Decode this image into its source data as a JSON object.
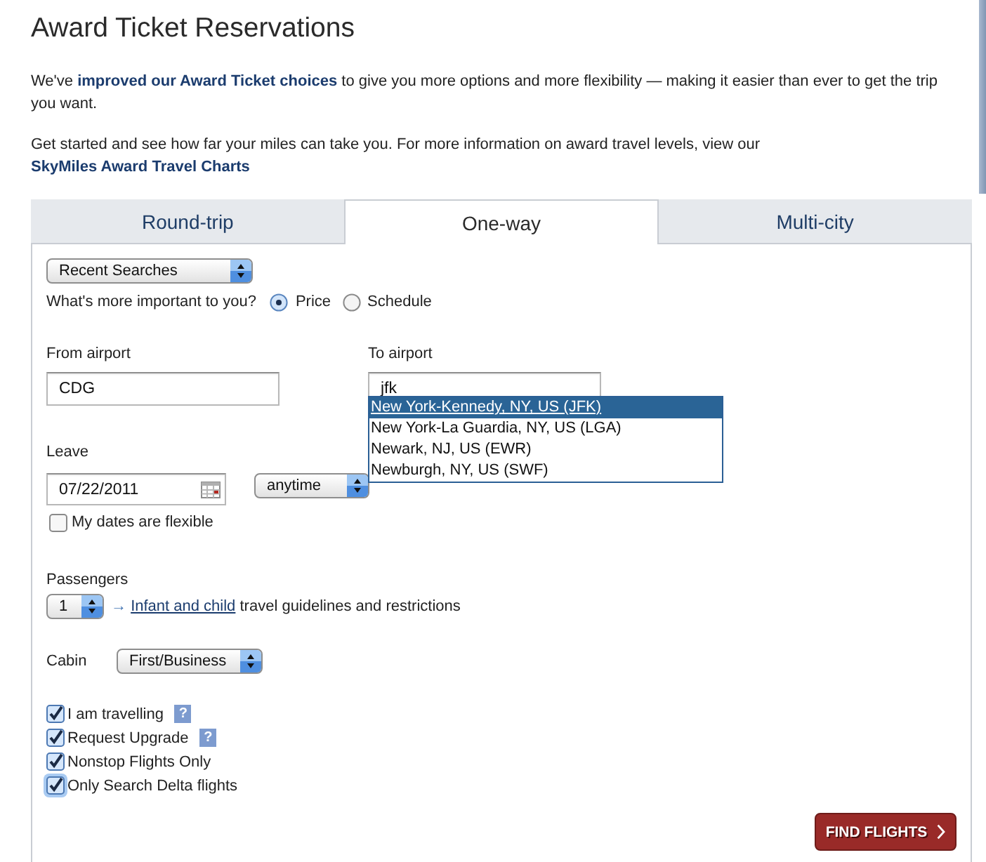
{
  "page": {
    "title": "Award Ticket Reservations"
  },
  "intro": [
    {
      "text": "We've ",
      "link": "improved our Award Ticket choices",
      "rest": " to give you more options and more flexibility — making it easier than ever to get the trip you want."
    },
    {
      "text": "Get started and see how far your miles can take you. For more information on award travel levels, view our ",
      "link": "SkyMiles Award Travel Charts"
    }
  ],
  "tabs": [
    {
      "label": "Round-trip",
      "selected": false
    },
    {
      "label": "One-way",
      "selected": true
    },
    {
      "label": "Multi-city",
      "selected": false
    }
  ],
  "recent_searches": {
    "value": "Recent Searches"
  },
  "preference": {
    "label": "What's more important to you?",
    "options": [
      {
        "label": "Price",
        "selected": true
      },
      {
        "label": "Schedule",
        "selected": false
      }
    ]
  },
  "from_airport": {
    "label": "From airport",
    "value": "CDG"
  },
  "to_airport": {
    "label": "To airport",
    "value": "jfk",
    "suggestions": [
      {
        "label": "New York-Kennedy, NY, US (JFK)",
        "selected": true
      },
      {
        "label": "New York-La Guardia, NY, US (LGA)",
        "selected": false
      },
      {
        "label": "Newark, NJ, US (EWR)",
        "selected": false
      },
      {
        "label": "Newburgh, NY, US (SWF)",
        "selected": false
      }
    ]
  },
  "leave": {
    "label": "Leave",
    "date": "07/22/2011",
    "time": "anytime",
    "flexible": {
      "label": "My dates are flexible",
      "checked": false
    }
  },
  "passengers": {
    "label": "Passengers",
    "value": "1",
    "arrow": "→",
    "link": "Infant and child",
    "rest": " travel guidelines and restrictions"
  },
  "cabin": {
    "label": "Cabin",
    "value": "First/Business"
  },
  "options": [
    {
      "label": "I am travelling",
      "checked": true,
      "help": "?",
      "focused": false
    },
    {
      "label": "Request Upgrade",
      "checked": true,
      "help": "?",
      "focused": false
    },
    {
      "label": "Nonstop Flights Only",
      "checked": true,
      "focused": false
    },
    {
      "label": "Only Search Delta flights",
      "checked": true,
      "focused": true
    }
  ],
  "find_button": {
    "label": "FIND FLIGHTS"
  }
}
